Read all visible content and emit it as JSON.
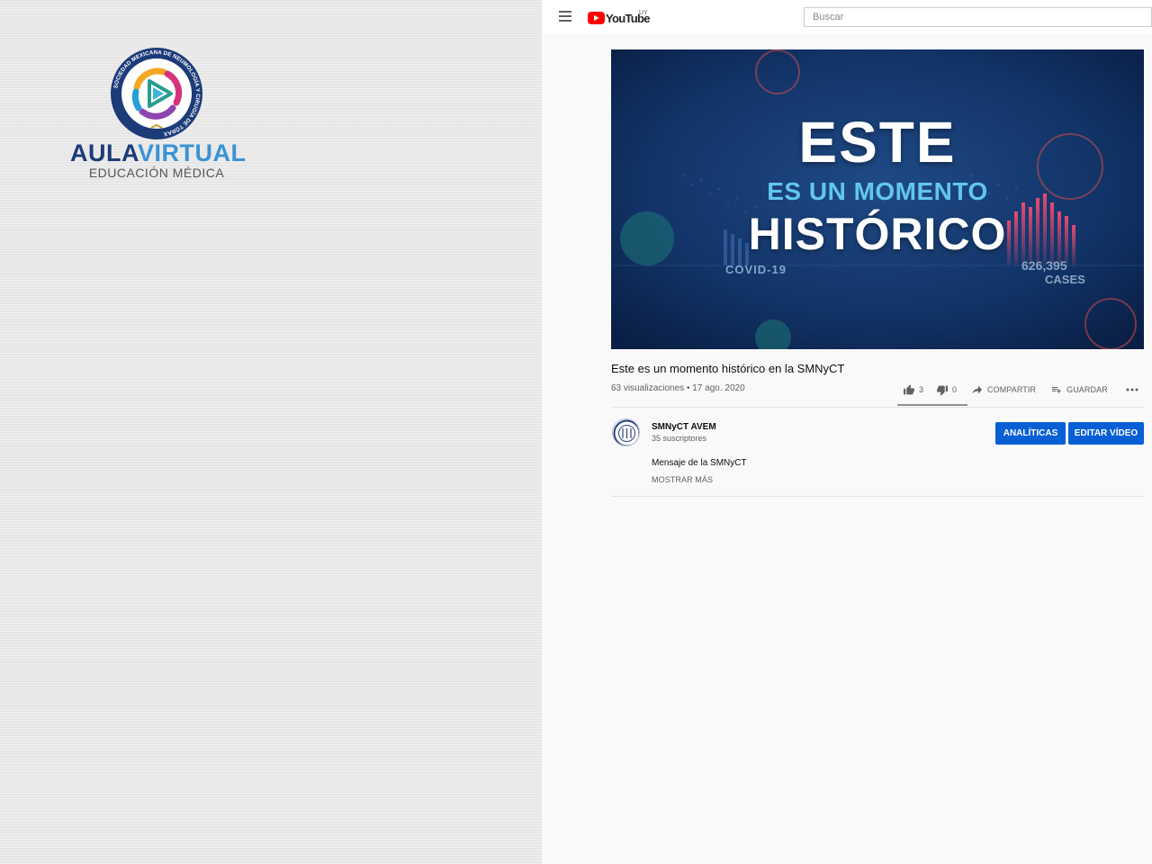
{
  "brand": {
    "seal_text": "SOCIEDAD MEXICANA DE NEUMOLOGÍA Y CIRUGÍA DE TÓRAX",
    "name_part1": "AULA",
    "name_part2": "VIRTUAL",
    "subtitle": "EDUCACIÓN MÉDICA"
  },
  "youtube": {
    "logo_text": "YouTube",
    "country_code": "UY",
    "search": {
      "placeholder": "Buscar",
      "value": ""
    }
  },
  "video": {
    "thumbnail": {
      "line1": "ESTE",
      "line2": "ES UN MOMENTO",
      "line3": "HISTÓRICO",
      "tag": "COVID-19",
      "cases_number": "626,395",
      "cases_label": "CASES"
    },
    "title": "Este es un momento histórico en la SMNyCT",
    "views": "63 visualizaciones",
    "separator": "•",
    "date": "17 ago. 2020",
    "likes": "3",
    "dislikes": "0",
    "like_ratio": 1.0,
    "share_label": "Compartir",
    "save_label": "Guardar"
  },
  "channel": {
    "name": "SMNyCT AVEM",
    "subscribers": "35 suscriptores",
    "analytics_label": "Analíticas",
    "edit_label": "Editar vídeo"
  },
  "description": {
    "text": "Mensaje de la SMNyCT",
    "show_more": "Mostrar más"
  },
  "colors": {
    "accent_blue": "#065fd4",
    "youtube_red": "#ff0000",
    "brand_navy": "#1c3b78",
    "brand_light_blue": "#3a93d3"
  }
}
